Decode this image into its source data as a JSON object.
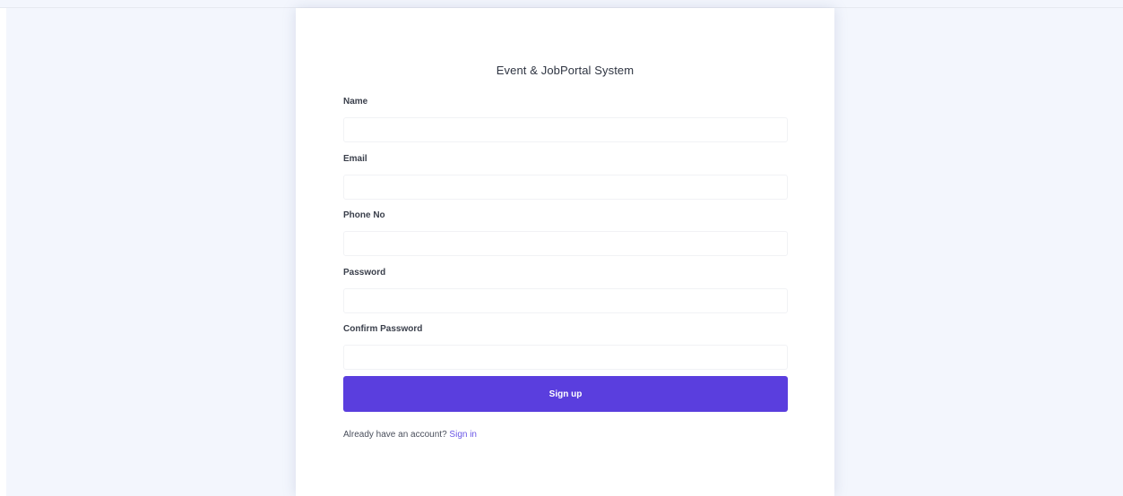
{
  "app": {
    "title": "Event & JobPortal System"
  },
  "form": {
    "fields": [
      {
        "label": "Name",
        "value": "",
        "placeholder": ""
      },
      {
        "label": "Email",
        "value": "",
        "placeholder": ""
      },
      {
        "label": "Phone No",
        "value": "",
        "placeholder": ""
      },
      {
        "label": "Password",
        "value": "",
        "placeholder": ""
      },
      {
        "label": "Confirm Password",
        "value": "",
        "placeholder": ""
      }
    ],
    "submit_label": "Sign up",
    "signin_prompt": "Already have an account?",
    "signin_link": "Sign in"
  },
  "colors": {
    "background": "#f3f6fd",
    "card": "#ffffff",
    "primary": "#5a3ede",
    "link": "#6a56e6"
  }
}
